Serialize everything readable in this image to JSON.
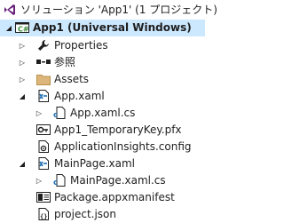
{
  "tree": {
    "solution": {
      "label": "ソリューション 'App1' (1 プロジェクト)"
    },
    "project": {
      "label": "App1 (Universal Windows)"
    },
    "items": [
      {
        "label": "Properties"
      },
      {
        "label": "参照"
      },
      {
        "label": "Assets"
      },
      {
        "label": "App.xaml"
      },
      {
        "label": "App.xaml.cs"
      },
      {
        "label": "App1_TemporaryKey.pfx"
      },
      {
        "label": "ApplicationInsights.config"
      },
      {
        "label": "MainPage.xaml"
      },
      {
        "label": "MainPage.xaml.cs"
      },
      {
        "label": "Package.appxmanifest"
      },
      {
        "label": "project.json"
      }
    ]
  },
  "icons": {
    "solution": "visual-studio-solution-icon",
    "project": "csharp-project-icon",
    "properties": "wrench-icon",
    "references": "references-icon",
    "assets": "folder-icon",
    "xaml": "xaml-file-icon",
    "cs": "csharp-file-icon",
    "key": "certificate-key-icon",
    "config": "config-file-icon",
    "manifest": "manifest-icon",
    "json": "json-file-icon"
  },
  "colors": {
    "selection_bg": "#cce8ff",
    "folder": "#dcb67a",
    "vs_purple": "#68217a",
    "csharp_green": "#388a34",
    "xaml_blue": "#1e6fb5"
  }
}
